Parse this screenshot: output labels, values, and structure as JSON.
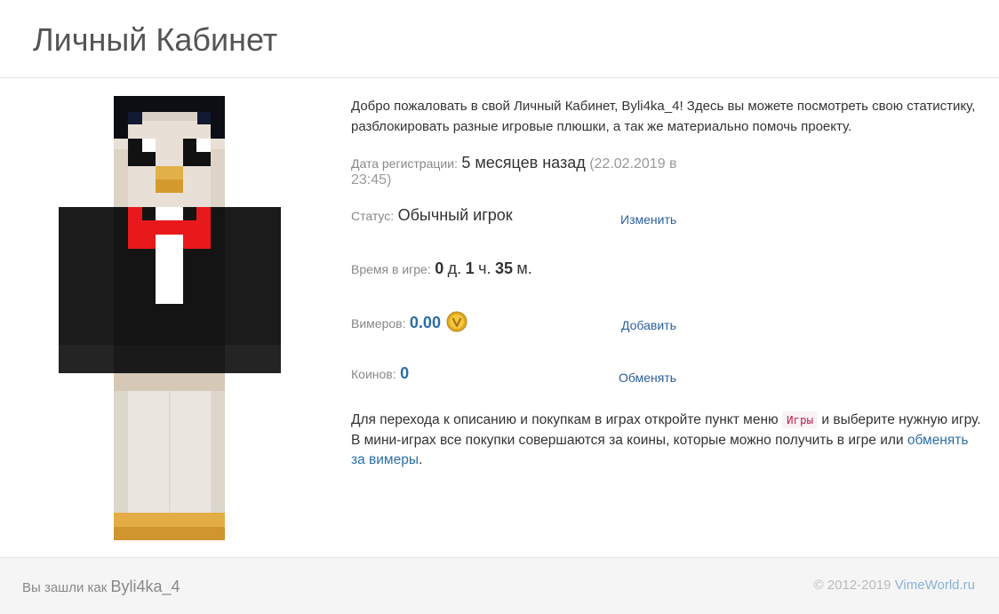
{
  "header": {
    "title": "Личный Кабинет"
  },
  "welcome": {
    "prefix": "Добро пожаловать в свой Личный Кабинет, ",
    "username": "Byli4ka_4",
    "suffix": "! Здесь вы можете посмотреть свою статистику, разблокировать разные игровые плюшки, а так же материально помочь проекту."
  },
  "registration": {
    "label": "Дата регистрации:",
    "value": "5 месяцев назад",
    "exact": "(22.02.2019 в 23:45)"
  },
  "status": {
    "label": "Статус:",
    "value": "Обычный игрок",
    "action": "Изменить"
  },
  "playtime": {
    "label": "Время в игре:",
    "days": "0",
    "days_unit": "д.",
    "hours": "1",
    "hours_unit": "ч.",
    "minutes": "35",
    "minutes_unit": "м."
  },
  "vimers": {
    "label": "Вимеров:",
    "value": "0.00",
    "icon": "vimer-coin-icon",
    "action": "Добавить"
  },
  "coins": {
    "label": "Коинов:",
    "value": "0",
    "action": "Обменять"
  },
  "info": {
    "part1": "Для перехода к описанию и покупкам в играх откройте пункт меню",
    "menu_item": "Игры",
    "part2": "и выберите нужную игру. В мини-играх все покупки совершаются за коины, которые можно получить в игре или",
    "link": "обменять за вимеры",
    "part3": "."
  },
  "footer": {
    "logged_in_as": "Вы зашли как",
    "username": "Byli4ka_4",
    "copyright": "© 2012-2019",
    "site": "VimeWorld.ru"
  },
  "colors": {
    "link": "#2a6ea6",
    "accent_value": "#2a6ea6",
    "code_text": "#c7254e",
    "code_bg": "#f9f2f4",
    "footer_bg": "#f5f5f5"
  }
}
